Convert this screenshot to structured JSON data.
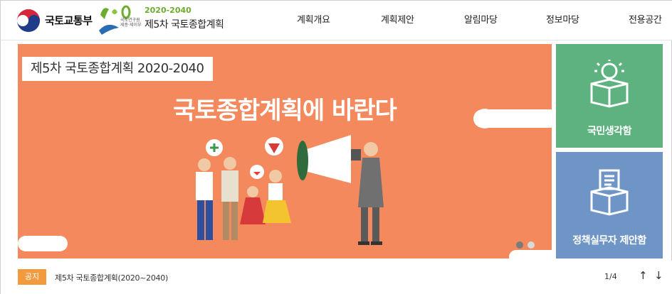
{
  "header": {
    "ministry_name": "국토교통부",
    "plan_years": "2020-2040",
    "plan_title": "제5차 국토종합계획",
    "plan_small_text": "국토연구원 세종·세이부"
  },
  "nav": [
    {
      "label": "계획개요"
    },
    {
      "label": "계획제안"
    },
    {
      "label": "알림마당"
    },
    {
      "label": "정보마당"
    },
    {
      "label": "전용공간"
    }
  ],
  "banner": {
    "tag": "제5차 국토종합계획 2020-2040",
    "headline": "국토종합계획에 바란다"
  },
  "tiles": {
    "citizen": "국민생각함",
    "official": "정책실무자 제안함"
  },
  "notice": {
    "badge": "공지",
    "text": "제5차 국토종합계획(2020~2040)",
    "pager": "1/4",
    "up": "↑",
    "down": "↓"
  },
  "colors": {
    "banner_bg": "#f3895d",
    "tile_green": "#5db27f",
    "tile_blue": "#6f95c7",
    "badge": "#f39a3e",
    "accent_green": "#6cad2e"
  }
}
